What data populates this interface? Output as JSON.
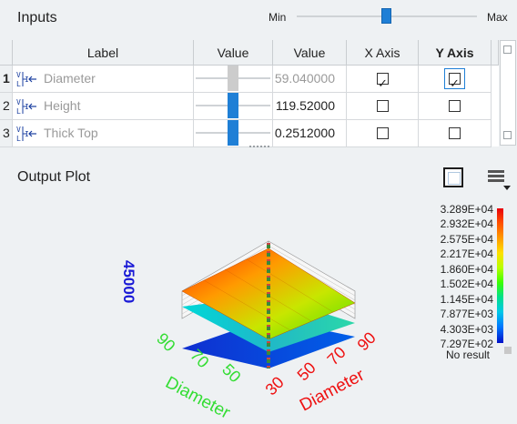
{
  "inputs": {
    "title": "Inputs",
    "slider": {
      "min_label": "Min",
      "max_label": "Max",
      "position": 0.5
    }
  },
  "table": {
    "columns": [
      "Label",
      "Value",
      "Value",
      "X Axis",
      "Y Axis"
    ],
    "rows": [
      {
        "num": "1",
        "label": "Diameter",
        "value": "59.040000",
        "slider_level": 0.5,
        "x_checked": true,
        "y_checked": true,
        "active": true
      },
      {
        "num": "2",
        "label": "Height",
        "value": "119.52000",
        "slider_level": 0.5,
        "x_checked": false,
        "y_checked": false,
        "active": false
      },
      {
        "num": "3",
        "label": "Thick Top",
        "value": "0.2512000",
        "slider_level": 0.5,
        "x_checked": false,
        "y_checked": false,
        "active": false
      }
    ]
  },
  "plot": {
    "title": "Output Plot",
    "z_axis_label": "45000",
    "left_axis": {
      "ticks": [
        "90",
        "70",
        "50"
      ],
      "label": "Diameter",
      "color": "#33dd33"
    },
    "right_axis": {
      "ticks": [
        "30",
        "50",
        "70",
        "90"
      ],
      "label": "Diameter",
      "color": "#ee1111"
    },
    "z_color": "#1a1ad6"
  },
  "legend": {
    "values": [
      "3.289E+04",
      "2.932E+04",
      "2.575E+04",
      "2.217E+04",
      "1.860E+04",
      "1.502E+04",
      "1.145E+04",
      "7.877E+03",
      "4.303E+03",
      "7.297E+02"
    ],
    "no_result": "No result"
  },
  "icons": {
    "row_type": "vector-variable-icon",
    "view": "plot-view-icon",
    "menu": "menu-icon"
  }
}
